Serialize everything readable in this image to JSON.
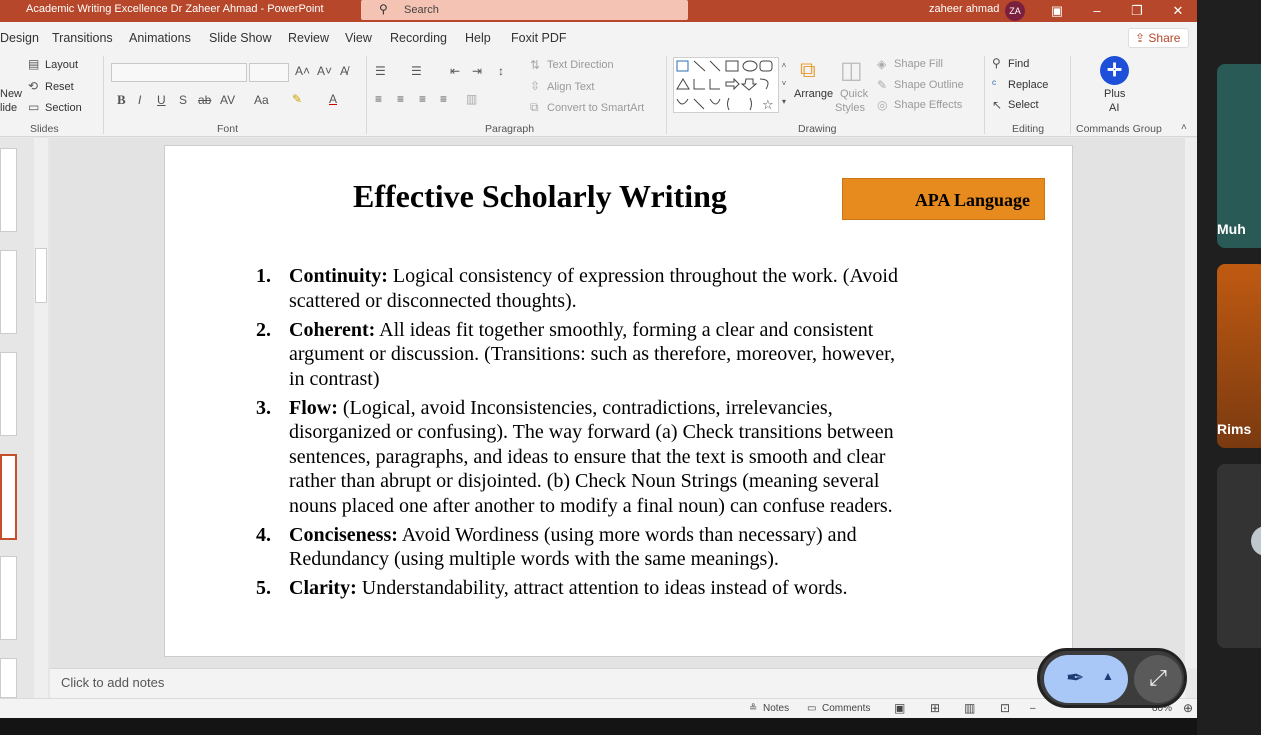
{
  "window": {
    "title": "Academic Writing Excellence Dr Zaheer Ahmad  -  PowerPoint",
    "search_placeholder": "Search",
    "user_name": "zaheer ahmad",
    "user_initials": "ZA"
  },
  "menu": {
    "tabs": [
      "Design",
      "Transitions",
      "Animations",
      "Slide Show",
      "Review",
      "View",
      "Recording",
      "Help",
      "Foxit PDF"
    ],
    "share_label": "Share"
  },
  "ribbon": {
    "slides": {
      "new_slide_1": "New",
      "new_slide_2": "lide",
      "layout": "Layout",
      "reset": "Reset",
      "section": "Section",
      "group": "Slides"
    },
    "font": {
      "group": "Font"
    },
    "paragraph": {
      "text_direction": "Text Direction",
      "align_text": "Align Text",
      "convert_smartart": "Convert to SmartArt",
      "group": "Paragraph"
    },
    "drawing": {
      "arrange": "Arrange",
      "quick_styles_1": "Quick",
      "quick_styles_2": "Styles",
      "shape_fill": "Shape Fill",
      "shape_outline": "Shape Outline",
      "shape_effects": "Shape Effects",
      "group": "Drawing"
    },
    "editing": {
      "find": "Find",
      "replace": "Replace",
      "select": "Select",
      "group": "Editing"
    },
    "commands": {
      "plus_ai_1": "Plus",
      "plus_ai_2": "AI",
      "group": "Commands Group"
    }
  },
  "slide": {
    "title": "Effective Scholarly Writing",
    "badge": "APA Language",
    "items": [
      {
        "num": "1.",
        "term": "Continuity:",
        "line1": " Logical consistency of expression throughout the work. (Avoid",
        "line2": "scattered or disconnected thoughts)."
      },
      {
        "num": "2.",
        "term": "Coherent:",
        "line1": " All ideas fit together smoothly, forming a clear and consistent",
        "line2": "argument or discussion. (Transitions: such as therefore, moreover, however,",
        "line3": "in contrast)"
      },
      {
        "num": "3.",
        "term": "Flow:",
        "line1": " (Logical, avoid Inconsistencies, contradictions, irrelevancies,",
        "line2": "disorganized or confusing). The way forward (a) Check transitions between",
        "line3": "sentences, paragraphs, and ideas to ensure that the text is smooth and clear",
        "line4": "rather than abrupt or disjointed. (b) Check Noun Strings (meaning several",
        "line5": "nouns placed one after another to modify a final noun) can confuse readers."
      },
      {
        "num": "4.",
        "term": "Conciseness:",
        "line1": " Avoid Wordiness (using more words than necessary) and",
        "line2": "Redundancy (using multiple words with the same meanings)."
      },
      {
        "num": "5.",
        "term": "Clarity:",
        "line1": " Understandability, attract attention to ideas instead of words."
      }
    ]
  },
  "notes_placeholder": "Click to add notes",
  "status": {
    "notes": "Notes",
    "comments": "Comments",
    "zoom": "80%"
  },
  "meeting": {
    "participant_1": "Muh",
    "participant_2": "Rims"
  },
  "colors": {
    "accent": "#b7472a",
    "badge": "#e88b1f"
  }
}
